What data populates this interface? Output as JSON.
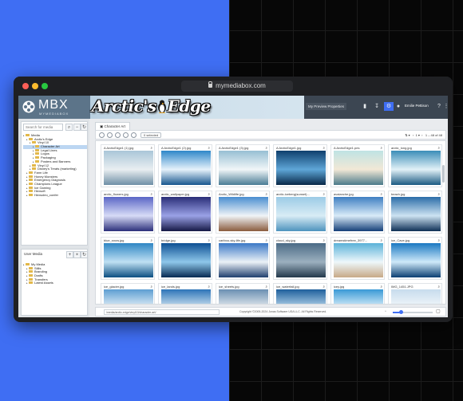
{
  "browser": {
    "url": "mymediabox.com"
  },
  "app": {
    "logo_text": "MBX",
    "logo_sub": "MYMEDIABOX",
    "banner_left": "Arctic's",
    "banner_right": "Edge",
    "preview_properties": "My Preview Properties",
    "user": "Emilie Pettison"
  },
  "sidebar": {
    "search_placeholder": "Search for media",
    "tree": [
      {
        "label": "Media",
        "level": 0
      },
      {
        "label": "Arctic's Edge",
        "level": 1
      },
      {
        "label": "Vinyl 10",
        "level": 2
      },
      {
        "label": "Character Art",
        "level": 3,
        "selected": true
      },
      {
        "label": "Legal Lines",
        "level": 3
      },
      {
        "label": "Logos",
        "level": 3
      },
      {
        "label": "Packaging",
        "level": 3
      },
      {
        "label": "Posters and Banners",
        "level": 3
      },
      {
        "label": "Vinyl 12",
        "level": 2
      },
      {
        "label": "Disney's Treats (marketing)",
        "level": 2
      },
      {
        "label": "Farm Life",
        "level": 1
      },
      {
        "label": "Honey Monsters",
        "level": 1
      },
      {
        "label": "Emergency Diagnosis",
        "level": 1
      },
      {
        "label": "Champions League",
        "level": 1
      },
      {
        "label": "Ice Gaming",
        "level": 1
      },
      {
        "label": "Hexsoft",
        "level": 1
      },
      {
        "label": "Hexsoleo_confer",
        "level": 1
      }
    ],
    "user_media_title": "User Media",
    "user_tree": [
      {
        "label": "My Media",
        "level": 0
      },
      {
        "label": "Stills",
        "level": 1
      },
      {
        "label": "Branding",
        "level": 1
      },
      {
        "label": "Drafts",
        "level": 1
      },
      {
        "label": "Transfers",
        "level": 1
      },
      {
        "label": "Latest Assets",
        "level": 1
      }
    ]
  },
  "main": {
    "tab_label": "Character Art",
    "selected_label": "0 selected",
    "pager_text": "1 – 48 of 48",
    "items": [
      {
        "name": "A ArcticEdge1 (1).jpg",
        "colors": [
          "#aac6d8",
          "#e9eef1",
          "#6e8fa6"
        ]
      },
      {
        "name": "A ArcticEdge1 (2).jpg",
        "colors": [
          "#2f87c9",
          "#e6f2fb",
          "#17568e"
        ]
      },
      {
        "name": "A ArcticEdge1 (3).jpg",
        "colors": [
          "#97bfd3",
          "#f1f6f8",
          "#4a7c95"
        ]
      },
      {
        "name": "A ArcticEdge1.jpg",
        "colors": [
          "#0f3f6d",
          "#5fa6d7",
          "#082848"
        ]
      },
      {
        "name": "A ArcticEdge1.pes",
        "colors": [
          "#bfe3e4",
          "#f2e8d6",
          "#4b7a8a"
        ]
      },
      {
        "name": "arctic_long.jpg",
        "colors": [
          "#3b8db8",
          "#e2f1f7",
          "#1b5a82"
        ]
      },
      {
        "name": "arctic_flowers.jpg",
        "colors": [
          "#5a66c6",
          "#d7dbf6",
          "#2b2f7a"
        ]
      },
      {
        "name": "arctic_wallpaper.jpg",
        "colors": [
          "#2a2e78",
          "#9aa1e6",
          "#151845"
        ]
      },
      {
        "name": "Arctic_Wildlife.jpg",
        "colors": [
          "#4a8ed0",
          "#f0f4f7",
          "#8a5b3d"
        ]
      },
      {
        "name": "arctic-iceberg(sunset)...",
        "colors": [
          "#9ccbe6",
          "#d8ecf5",
          "#4d93bd"
        ]
      },
      {
        "name": "avalanche.jpg",
        "colors": [
          "#3f7fc2",
          "#d9ebf8",
          "#143f78"
        ]
      },
      {
        "name": "beach.jpg",
        "colors": [
          "#2b6ca8",
          "#cde3f2",
          "#0e2f55"
        ]
      },
      {
        "name": "blue_snow.jpg",
        "colors": [
          "#2f86c4",
          "#bfe0f3",
          "#0c4f82"
        ]
      },
      {
        "name": "bridge.jpg",
        "colors": [
          "#0d4f93",
          "#8ec7ea",
          "#062a52"
        ]
      },
      {
        "name": "caribou-sky-life.jpg",
        "colors": [
          "#3b78c6",
          "#ecf2f7",
          "#1f3f6e"
        ]
      },
      {
        "name": "cloud_sky.jpg",
        "colors": [
          "#4b6b86",
          "#9cb0bf",
          "#22384b"
        ]
      },
      {
        "name": "dreamstimefree_3977...",
        "colors": [
          "#5ab2d8",
          "#eef7fb",
          "#c7a987"
        ]
      },
      {
        "name": "ice_Cave.jpg",
        "colors": [
          "#1a78c2",
          "#cfe9f9",
          "#0a3f72"
        ]
      },
      {
        "name": "ice_glacier.jpg",
        "colors": [
          "#5d9ed2",
          "#e7f2f9",
          "#2e6a9e"
        ]
      },
      {
        "name": "ice_lands.jpg",
        "colors": [
          "#2d74b8",
          "#d5e8f4",
          "#f2f6f8"
        ]
      },
      {
        "name": "ice_sheets.jpg",
        "colors": [
          "#6a8fb2",
          "#e9eef2",
          "#3b5f82"
        ]
      },
      {
        "name": "ice_waterfall.jpg",
        "colors": [
          "#1e5f9c",
          "#b9d8ee",
          "#0c2f55"
        ]
      },
      {
        "name": "icey.jpg",
        "colors": [
          "#3a99d6",
          "#dff2fb",
          "#156aa3"
        ]
      },
      {
        "name": "IMG_1451.JPG",
        "colors": [
          "#c7dced",
          "#f4f8fb",
          "#7da5c6"
        ]
      }
    ]
  },
  "footer": {
    "path": "/media/arctic-edge/vinyl10/character-art/",
    "copyright": "Copyright ©2005-2024 Jonas Software USA LLC. All Rights Reserved.",
    "zoom_level": 0.2
  }
}
